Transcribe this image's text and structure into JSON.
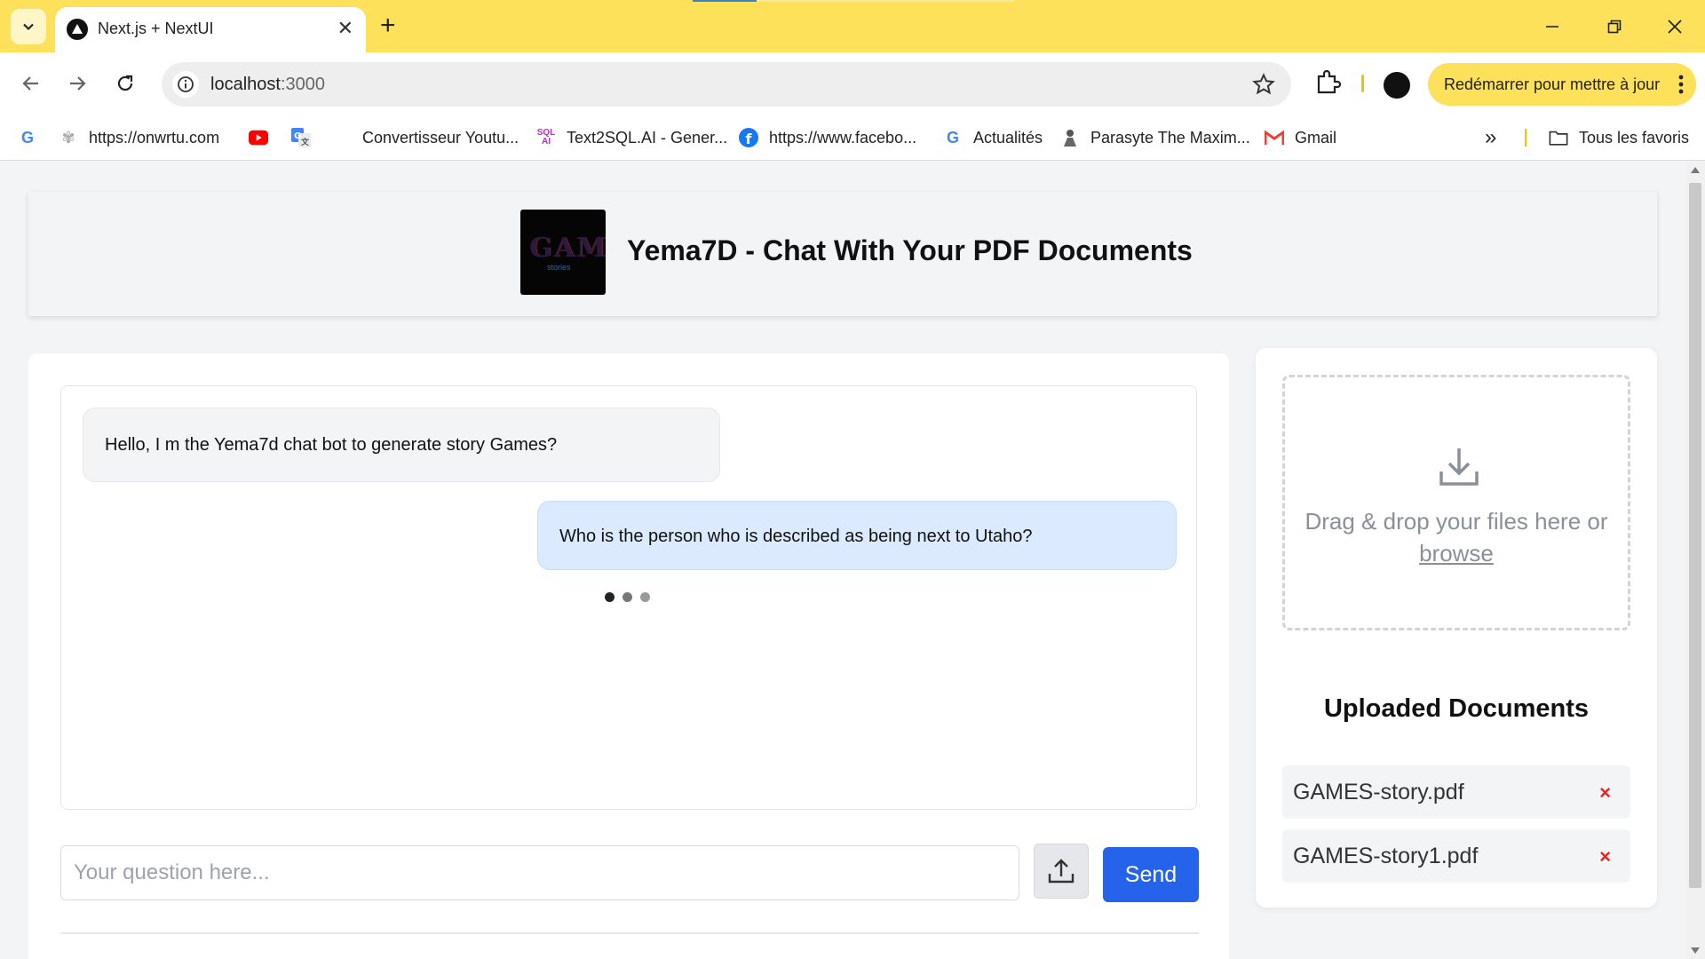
{
  "browser": {
    "tab_title": "Next.js + NextUI",
    "url_host": "localhost",
    "url_port": ":3000",
    "update_button": "Redémarrer pour mettre à jour",
    "new_tab": "+",
    "tab_close": "✕",
    "bookmarks": [
      {
        "label": "",
        "icon": "google-icon",
        "color": "#4285f4"
      },
      {
        "label": "https://onwrtu.com",
        "icon": "onwrtu-icon"
      },
      {
        "label": "",
        "icon": "youtube-icon",
        "color": "#ff0000"
      },
      {
        "label": "",
        "icon": "google-translate-icon",
        "color": "#4285f4"
      },
      {
        "label": "Convertisseur Youtu...",
        "icon": "none"
      },
      {
        "label": "Text2SQL.AI - Gener...",
        "icon": "text2sql-icon"
      },
      {
        "label": "https://www.facebo...",
        "icon": "facebook-icon",
        "color": "#1877f2"
      },
      {
        "label": "Actualités",
        "icon": "google-icon",
        "color": "#4285f4"
      },
      {
        "label": "Parasyte The Maxim...",
        "icon": "parasyte-icon"
      },
      {
        "label": "Gmail",
        "icon": "gmail-icon",
        "color": "#ea4335"
      }
    ],
    "overflow": "»",
    "all_bookmarks": "Tous les favoris"
  },
  "header": {
    "title": "Yema7D - Chat With Your PDF Documents",
    "logo_text": "GAME",
    "logo_subtext": "stories"
  },
  "chat": {
    "messages": [
      {
        "role": "bot",
        "text": "Hello, I m the Yema7d chat bot to generate story Games?"
      },
      {
        "role": "user",
        "text": "Who is the person who is described as being next to Utaho?"
      }
    ],
    "typing_dot_colors": [
      "#222222",
      "#777777",
      "#999999"
    ],
    "input_placeholder": "Your question here...",
    "send_label": "Send"
  },
  "upload": {
    "drop_text": "Drag & drop your files here or",
    "browse_text": "browse",
    "docs_title": "Uploaded Documents",
    "documents": [
      "GAMES-story.pdf",
      "GAMES-story1.pdf"
    ],
    "remove_symbol": "×"
  },
  "colors": {
    "chrome_accent": "#fde15a",
    "send_button": "#2563eb",
    "user_bubble": "#dbeafe",
    "remove_icon": "#e02424"
  }
}
